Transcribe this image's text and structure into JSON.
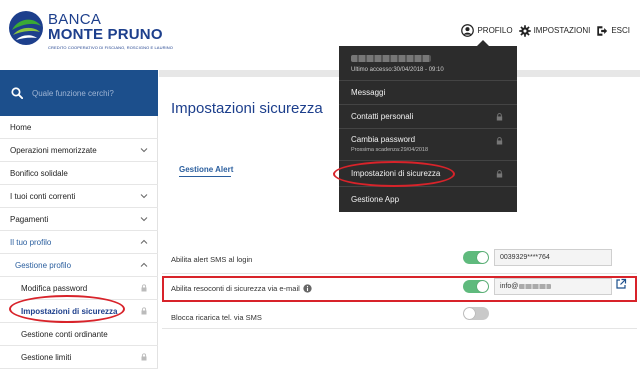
{
  "brand": {
    "banca": "BANCA",
    "name": "MONTE PRUNO",
    "subtitle": "CREDITO COOPERATIVO DI FISCIANO, ROSCIGNO E LAURINO"
  },
  "topnav": {
    "profile": "PROFILO",
    "settings": "IMPOSTAZIONI",
    "logout": "ESCI"
  },
  "profile_menu": {
    "last_access": "Ultimo accesso:30/04/2018 - 09:10",
    "items": [
      {
        "label": "Messaggi",
        "locked": false
      },
      {
        "label": "Contatti personali",
        "locked": true
      },
      {
        "label": "Cambia password",
        "sub": "Prossima scadenza:29/04/2018",
        "locked": true
      },
      {
        "label": "Impostazioni di sicurezza",
        "locked": true
      },
      {
        "label": "Gestione App",
        "locked": false
      }
    ]
  },
  "search": {
    "placeholder": "Quale funzione cerchi?"
  },
  "sidebar": {
    "items": [
      {
        "label": "Home"
      },
      {
        "label": "Operazioni memorizzate",
        "chevron": "down"
      },
      {
        "label": "Bonifico solidale"
      },
      {
        "label": "I tuoi conti correnti",
        "chevron": "down"
      },
      {
        "label": "Pagamenti",
        "chevron": "down"
      },
      {
        "label": "Il tuo profilo",
        "chevron": "up"
      },
      {
        "label": "Gestione profilo",
        "chevron": "up"
      },
      {
        "label": "Modifica password",
        "locked": true
      },
      {
        "label": "Impostazioni di sicurezza",
        "locked": true,
        "active": true
      },
      {
        "label": "Gestione conti ordinante"
      },
      {
        "label": "Gestione limiti",
        "locked": true
      }
    ]
  },
  "main": {
    "title": "Impostazioni sicurezza",
    "section": "Gestione Alert",
    "rows": [
      {
        "label": "Abilita alert SMS al login",
        "toggle": "on",
        "value": "0039329****764"
      },
      {
        "label": "Abilita resoconti di sicurezza via e-mail",
        "toggle": "on",
        "value": "info@"
      },
      {
        "label": "Blocca ricarica tel. via SMS",
        "toggle": "off"
      }
    ]
  },
  "colors": {
    "brand_blue": "#1d3f8c",
    "search_blue": "#1c4f8c",
    "menu_dark": "#2c2c2c",
    "toggle_on": "#5fba7d",
    "highlight_red": "#d8232a"
  }
}
